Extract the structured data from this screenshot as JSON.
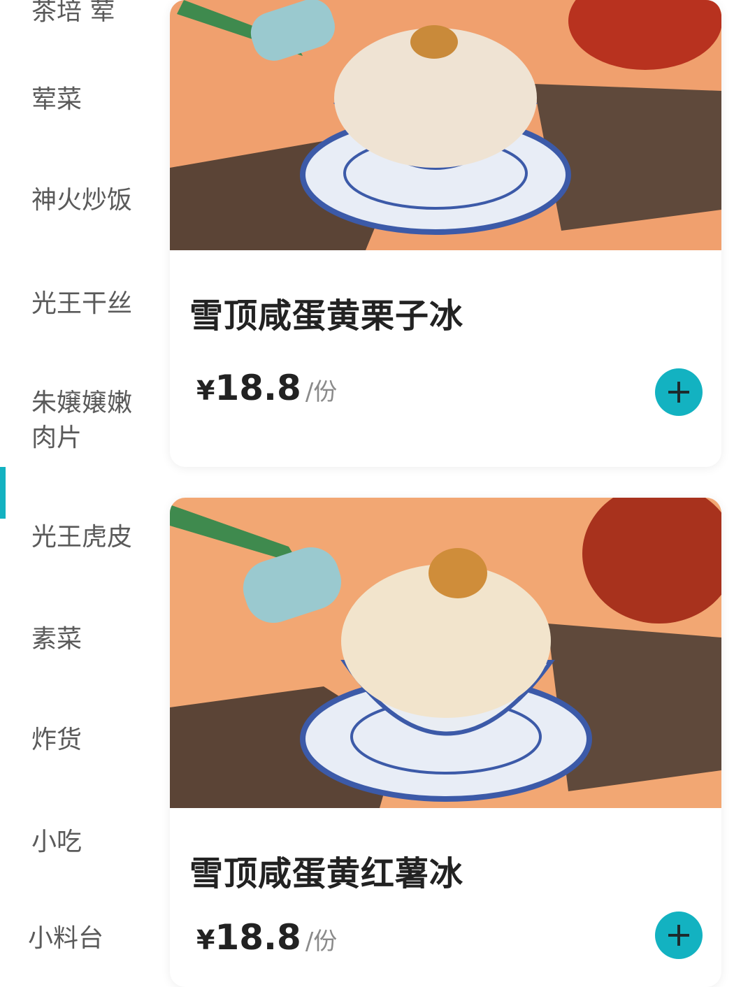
{
  "sidebar": {
    "items": [
      {
        "label": "茶培 荤"
      },
      {
        "label": "荤菜"
      },
      {
        "label": "神火炒饭"
      },
      {
        "label": "光王干丝"
      },
      {
        "label": "朱嬢嬢嫩肉片"
      },
      {
        "label": "光王虎皮"
      },
      {
        "label": "素菜"
      },
      {
        "label": "炸货"
      },
      {
        "label": "小吃"
      },
      {
        "label": "小料台"
      }
    ]
  },
  "products": [
    {
      "name": "雪顶咸蛋黄栗子冰",
      "currency": "¥",
      "price": "18.8",
      "unit": "/份"
    },
    {
      "name": "雪顶咸蛋黄红薯冰",
      "currency": "¥",
      "price": "18.8",
      "unit": "/份"
    }
  ],
  "colors": {
    "accent": "#13b2c1",
    "photo_background": "#f0a06e"
  },
  "icons": {
    "add": "plus-icon"
  }
}
